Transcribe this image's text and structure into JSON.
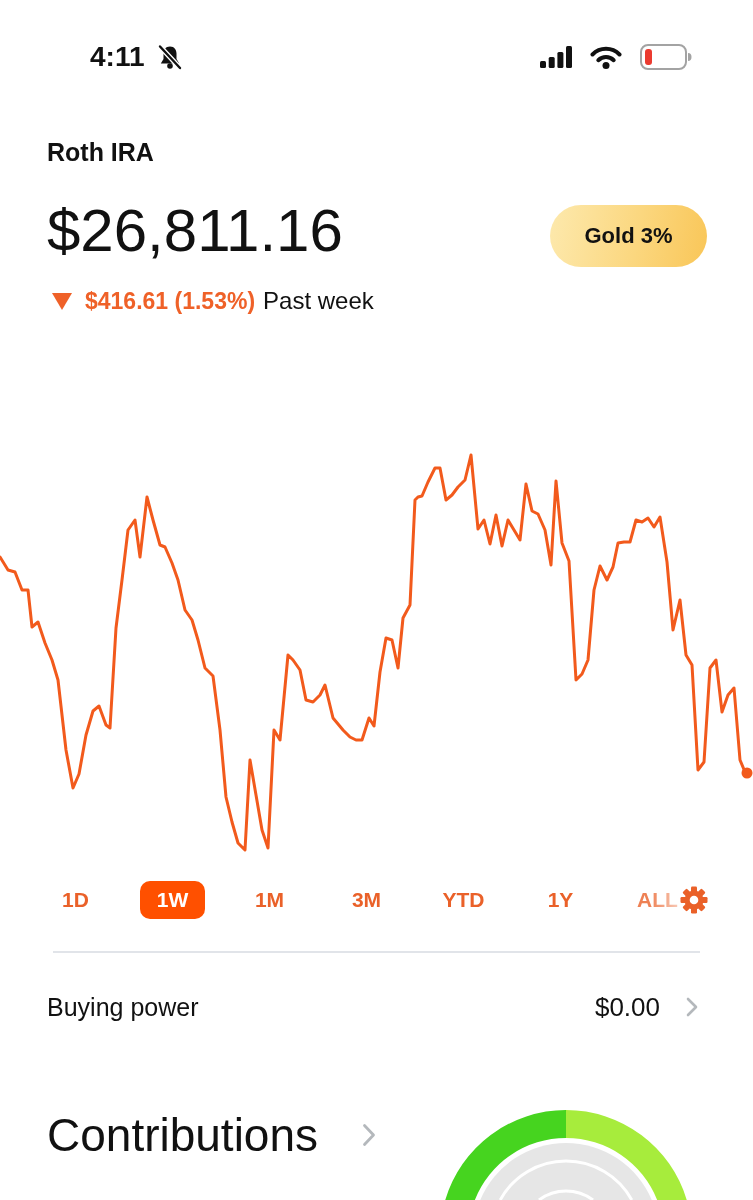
{
  "status_bar": {
    "time": "4:11",
    "muted": true
  },
  "account": {
    "name": "Roth IRA",
    "value": "$26,811.16",
    "gold_button": "Gold 3%",
    "change": {
      "down": true,
      "amount": "$416.61 (1.53%)",
      "period": "Past week"
    }
  },
  "range_tabs": [
    {
      "label": "1D",
      "selected": false
    },
    {
      "label": "1W",
      "selected": true
    },
    {
      "label": "1M",
      "selected": false
    },
    {
      "label": "3M",
      "selected": false
    },
    {
      "label": "YTD",
      "selected": false
    },
    {
      "label": "1Y",
      "selected": false
    },
    {
      "label": "ALL",
      "selected": false
    }
  ],
  "buying_power": {
    "label": "Buying power",
    "value": "$0.00"
  },
  "contributions": {
    "title": "Contributions",
    "ring_segments": [
      {
        "color": "#46d41f"
      },
      {
        "color": "#a7ec3c"
      }
    ]
  }
}
